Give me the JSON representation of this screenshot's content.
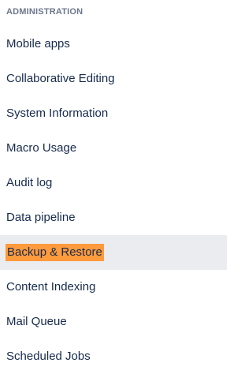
{
  "sidebar": {
    "heading": "ADMINISTRATION",
    "active_highlight_color": "#ff9a3d",
    "active_row_color": "#ebecf0",
    "items": [
      {
        "label": "Mobile apps"
      },
      {
        "label": "Collaborative Editing"
      },
      {
        "label": "System Information"
      },
      {
        "label": "Macro Usage"
      },
      {
        "label": "Audit log"
      },
      {
        "label": "Data pipeline"
      },
      {
        "label": "Backup & Restore",
        "active": true
      },
      {
        "label": "Content Indexing"
      },
      {
        "label": "Mail Queue"
      },
      {
        "label": "Scheduled Jobs"
      }
    ]
  }
}
